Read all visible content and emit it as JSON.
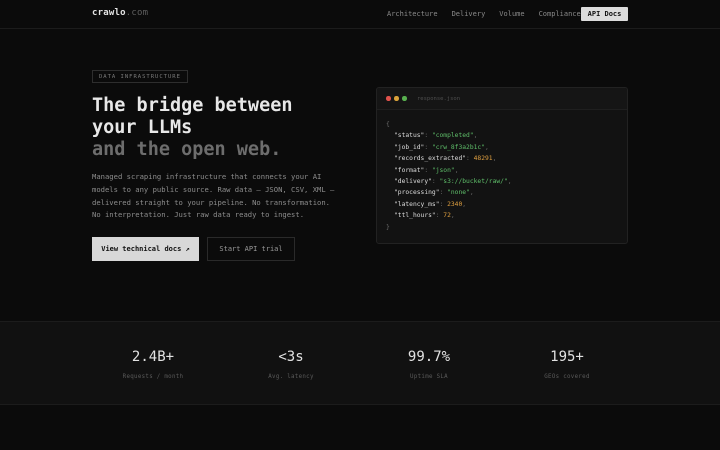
{
  "nav": {
    "logo_main": "crawlo",
    "logo_tld": ".com",
    "links": [
      "Architecture",
      "Delivery",
      "Volume",
      "Compliance"
    ],
    "api_button": "API Docs"
  },
  "hero": {
    "badge": "DATA INFRASTRUCTURE",
    "title_lines": [
      "The bridge between",
      "your LLMs"
    ],
    "title_dim": "and the open web.",
    "description_lines": [
      "Managed scraping infrastructure that connects your AI",
      "models to any public source. Raw data — JSON, CSV, XML —",
      "delivered straight to your pipeline. No transformation.",
      "No interpretation. Just raw data ready to ingest."
    ],
    "primary_button": "View technical docs ↗",
    "secondary_button": "Start API trial"
  },
  "code": {
    "filename": "response.json",
    "open_brace": "{",
    "close_brace": "}",
    "lines": [
      {
        "key": "\"status\"",
        "value": "\"completed\"",
        "type": "s"
      },
      {
        "key": "\"job_id\"",
        "value": "\"crw_8f3a2b1c\"",
        "type": "s"
      },
      {
        "key": "\"records_extracted\"",
        "value": "48291",
        "type": "n"
      },
      {
        "key": "\"format\"",
        "value": "\"json\"",
        "type": "s"
      },
      {
        "key": "\"delivery\"",
        "value": "\"s3://bucket/raw/\"",
        "type": "s"
      },
      {
        "key": "\"processing\"",
        "value": "\"none\"",
        "type": "s"
      },
      {
        "key": "\"latency_ms\"",
        "value": "2340",
        "type": "n"
      },
      {
        "key": "\"ttl_hours\"",
        "value": "72",
        "type": "n"
      }
    ],
    "dot_colors": [
      "#e0524c",
      "#d9a23a",
      "#58b04f"
    ]
  },
  "stats": [
    {
      "value": "2.4B+",
      "label": "Requests / month"
    },
    {
      "value": "<3s",
      "label": "Avg. latency"
    },
    {
      "value": "99.7%",
      "label": "Uptime SLA"
    },
    {
      "value": "195+",
      "label": "GEOs covered"
    }
  ]
}
